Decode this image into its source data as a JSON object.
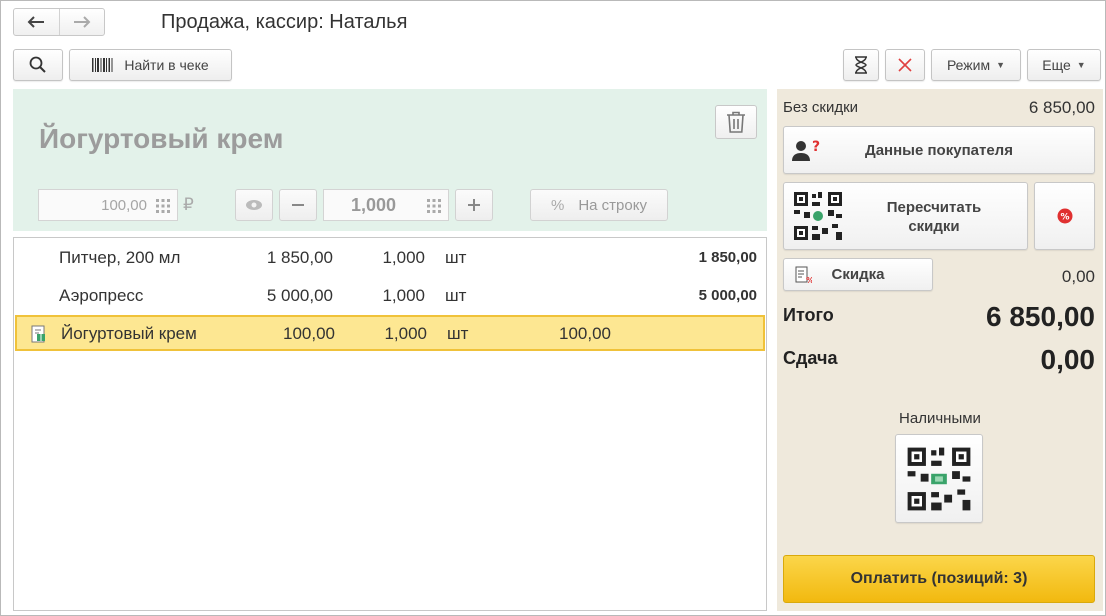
{
  "window": {
    "title": "Продажа, кассир: Наталья"
  },
  "toolbar": {
    "find_in_receipt": "Найти в чеке",
    "mode": "Режим",
    "more": "Еще"
  },
  "current_item": {
    "name": "Йогуртовый крем",
    "price": "100,00",
    "currency": "₽",
    "quantity": "1,000",
    "per_line_button": "На строку"
  },
  "receipt": {
    "rows": [
      {
        "name": "Питчер, 200 мл",
        "price": "1 850,00",
        "qty": "1,000",
        "unit": "шт",
        "discount": "",
        "sum": "1 850,00",
        "selected": false
      },
      {
        "name": "Аэропресс",
        "price": "5 000,00",
        "qty": "1,000",
        "unit": "шт",
        "discount": "",
        "sum": "5 000,00",
        "selected": false
      },
      {
        "name": "Йогуртовый крем",
        "price": "100,00",
        "qty": "1,000",
        "unit": "шт",
        "discount": "100,00",
        "sum": "",
        "selected": true
      }
    ]
  },
  "summary": {
    "no_discount_label": "Без скидки",
    "no_discount_value": "6 850,00",
    "customer_data": "Данные покупателя",
    "recalc_discounts_line1": "Пересчитать",
    "recalc_discounts_line2": "скидки",
    "discount_label": "Скидка",
    "discount_value": "0,00",
    "total_label": "Итого",
    "total_value": "6 850,00",
    "change_label": "Сдача",
    "change_value": "0,00",
    "cash_label": "Наличными",
    "pay_button": "Оплатить (позиций: 3)"
  },
  "colors": {
    "item_panel_bg": "#e3f2ea",
    "right_panel_bg": "#efe9dc",
    "selected_row_bg": "#fde792",
    "pay_button": "#f2b90f",
    "cancel_red": "#e04040"
  }
}
